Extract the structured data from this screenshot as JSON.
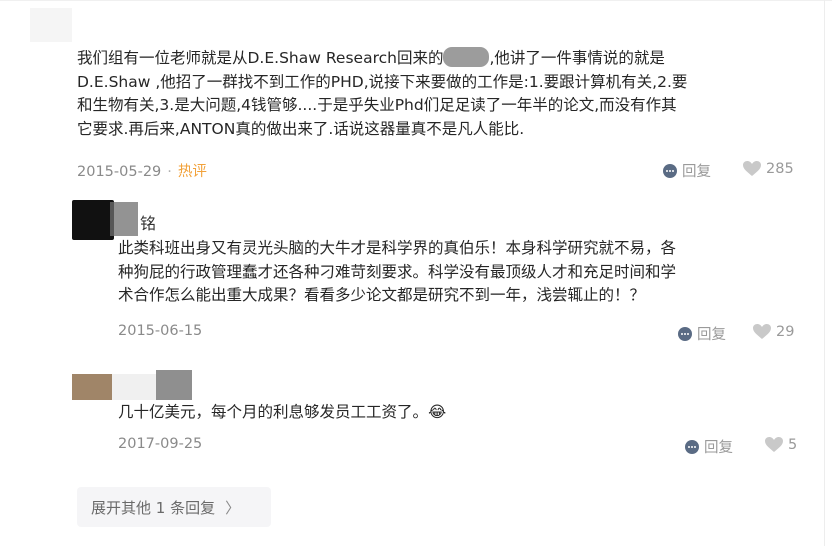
{
  "comments": [
    {
      "text_lines": [
        "我们组有一位老师就是从D.E.Shaw Research回来的",
        "D.E.Shaw ,他招了一群找不到工作的PHD,说接下来要做的工作是:1.要跟计算机有关,2.要",
        "和生物有关,3.是大问题,4钱管够....于是乎失业Phd们足足读了一年半的论文,而没有作其",
        "它要求.再后来,ANTON真的做出来了.话说这器量真不是凡人能比."
      ],
      "line1_tail": ",他讲了一件事情说的就是",
      "date": "2015-05-29",
      "hot_label": "热评",
      "reply_label": "回复",
      "like_count": "285"
    },
    {
      "author_fragment": "铭",
      "text_lines": [
        "此类科班出身又有灵光头脑的大牛才是科学界的真伯乐！本身科学研究就不易，各",
        "种狗屁的行政管理蠢才还各种刁难苛刻要求。科学没有最顶级人才和充足时间和学",
        "术合作怎么能出重大成果？看看多少论文都是研究不到一年，浅尝辄止的！？"
      ],
      "date": "2015-06-15",
      "reply_label": "回复",
      "like_count": "29"
    },
    {
      "text_lines": [
        "几十亿美元，每个月的利息够发员工工资了。😂"
      ],
      "date": "2017-09-25",
      "reply_label": "回复",
      "like_count": "5"
    }
  ],
  "expand": {
    "label": "展开其他 1 条回复",
    "chevron": "〉"
  }
}
